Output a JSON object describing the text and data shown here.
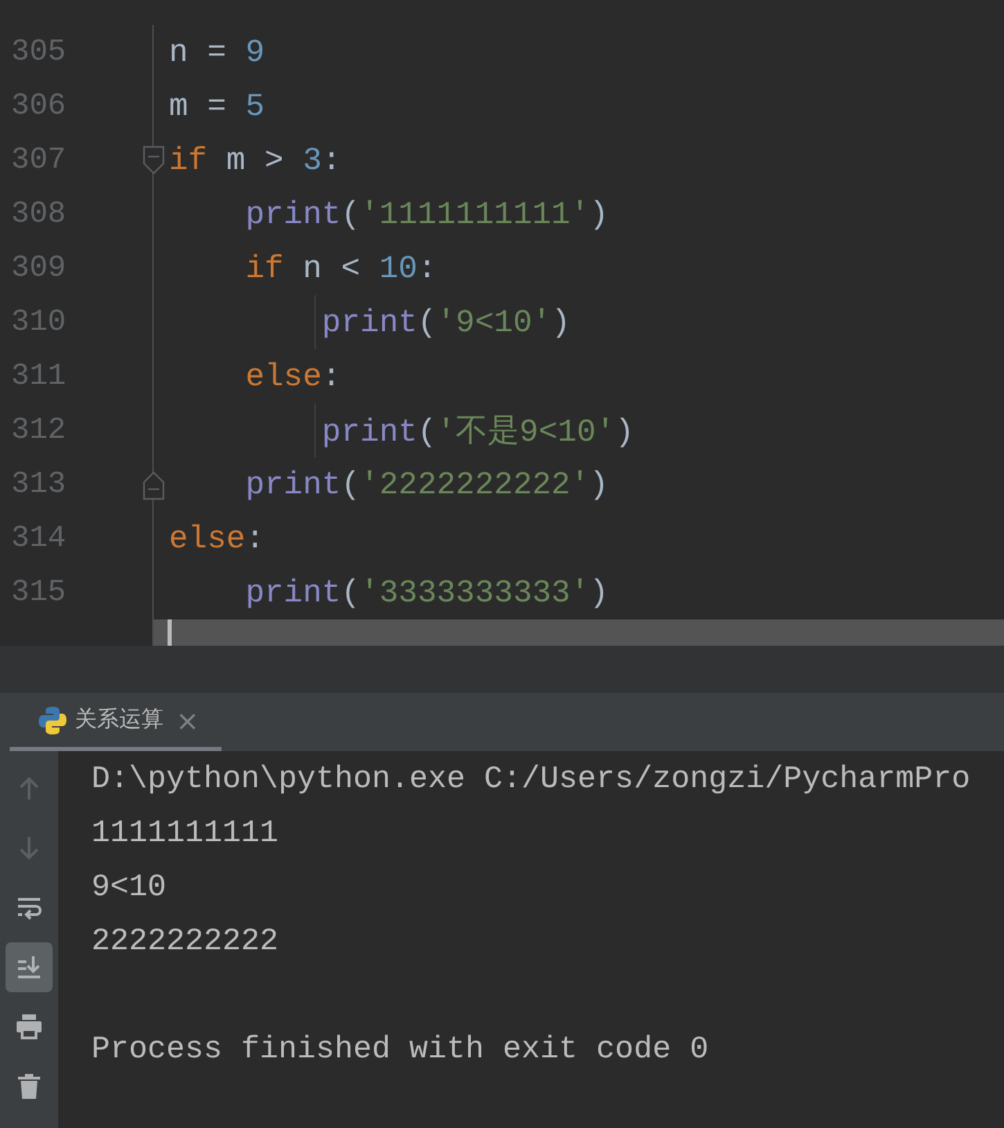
{
  "editor": {
    "lines": [
      {
        "number": "305",
        "tokens": [
          {
            "kind": "plain",
            "text": "n = "
          },
          {
            "kind": "number",
            "text": "9"
          }
        ]
      },
      {
        "number": "306",
        "tokens": [
          {
            "kind": "plain",
            "text": "m = "
          },
          {
            "kind": "number",
            "text": "5"
          }
        ]
      },
      {
        "number": "307",
        "fold_start": true,
        "tokens": [
          {
            "kind": "keyword",
            "text": "if"
          },
          {
            "kind": "plain",
            "text": " m > "
          },
          {
            "kind": "number",
            "text": "3"
          },
          {
            "kind": "plain",
            "text": ":"
          }
        ]
      },
      {
        "number": "308",
        "tokens": [
          {
            "kind": "builtin",
            "text": "    print"
          },
          {
            "kind": "plain",
            "text": "("
          },
          {
            "kind": "string",
            "text": "'1111111111'"
          },
          {
            "kind": "plain",
            "text": ")"
          }
        ]
      },
      {
        "number": "309",
        "tokens": [
          {
            "kind": "keyword",
            "text": "    if"
          },
          {
            "kind": "plain",
            "text": " n < "
          },
          {
            "kind": "number",
            "text": "10"
          },
          {
            "kind": "plain",
            "text": ":"
          }
        ]
      },
      {
        "number": "310",
        "guide": true,
        "tokens": [
          {
            "kind": "builtin",
            "text": "        print"
          },
          {
            "kind": "plain",
            "text": "("
          },
          {
            "kind": "string",
            "text": "'9<10'"
          },
          {
            "kind": "plain",
            "text": ")"
          }
        ]
      },
      {
        "number": "311",
        "tokens": [
          {
            "kind": "keyword",
            "text": "    else"
          },
          {
            "kind": "plain",
            "text": ":"
          }
        ]
      },
      {
        "number": "312",
        "guide": true,
        "tokens": [
          {
            "kind": "builtin",
            "text": "        print"
          },
          {
            "kind": "plain",
            "text": "("
          },
          {
            "kind": "string",
            "text": "'不是9<10'"
          },
          {
            "kind": "plain",
            "text": ")"
          }
        ]
      },
      {
        "number": "313",
        "fold_end": true,
        "tokens": [
          {
            "kind": "builtin",
            "text": "    print"
          },
          {
            "kind": "plain",
            "text": "("
          },
          {
            "kind": "string",
            "text": "'2222222222'"
          },
          {
            "kind": "plain",
            "text": ")"
          }
        ]
      },
      {
        "number": "314",
        "tokens": [
          {
            "kind": "keyword",
            "text": "else"
          },
          {
            "kind": "plain",
            "text": ":"
          }
        ]
      },
      {
        "number": "315",
        "tokens": [
          {
            "kind": "builtin",
            "text": "    print"
          },
          {
            "kind": "plain",
            "text": "("
          },
          {
            "kind": "string",
            "text": "'3333333333'"
          },
          {
            "kind": "plain",
            "text": ")"
          }
        ]
      },
      {
        "current": true
      }
    ]
  },
  "run_panel": {
    "tab": {
      "label": "关系运算",
      "close": "×",
      "selected": true
    },
    "toolbar": [
      {
        "kind": "up",
        "disabled": true,
        "selected": false
      },
      {
        "kind": "down",
        "disabled": true,
        "selected": false
      },
      {
        "kind": "wrap",
        "disabled": false,
        "selected": false
      },
      {
        "kind": "scroll-end",
        "disabled": false,
        "selected": true
      },
      {
        "kind": "print",
        "disabled": false,
        "selected": false
      },
      {
        "kind": "delete",
        "disabled": false,
        "selected": false
      }
    ],
    "console": [
      {
        "kind": "command",
        "text": "D:\\python\\python.exe C:/Users/zongzi/PycharmPro"
      },
      {
        "kind": "output",
        "text": "1111111111"
      },
      {
        "kind": "output",
        "text": "9<10"
      },
      {
        "kind": "output",
        "text": "2222222222"
      },
      {
        "kind": "status",
        "text": "Process finished with exit code 0"
      }
    ]
  }
}
